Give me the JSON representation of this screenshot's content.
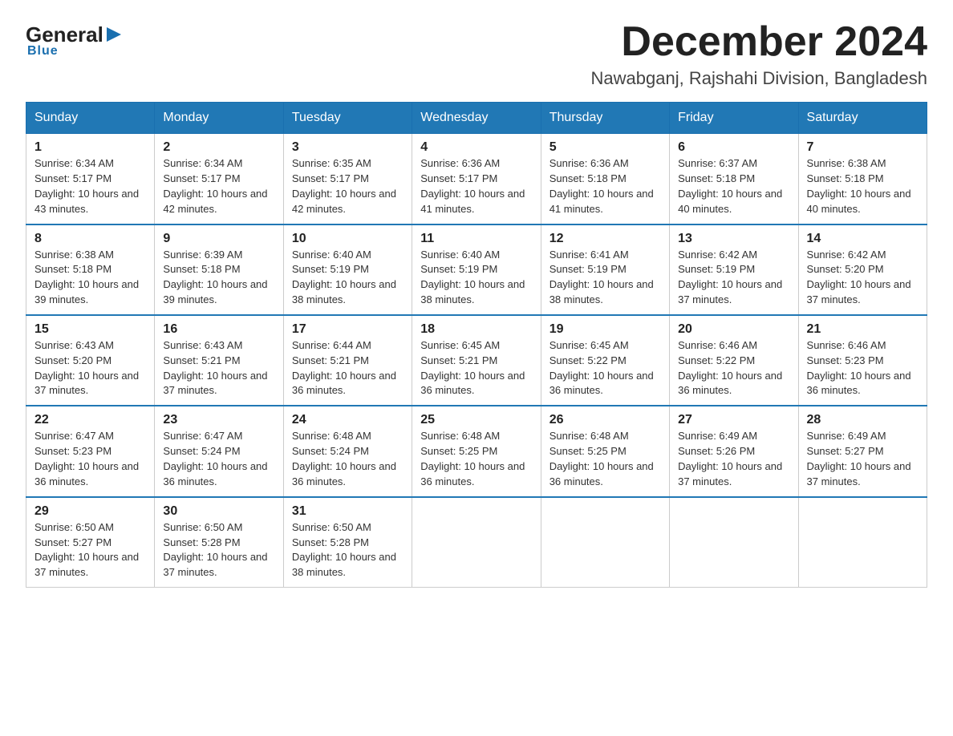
{
  "logo": {
    "general": "General",
    "blue": "Blue",
    "tagline": "Blue"
  },
  "header": {
    "title": "December 2024",
    "subtitle": "Nawabganj, Rajshahi Division, Bangladesh"
  },
  "calendar": {
    "days_of_week": [
      "Sunday",
      "Monday",
      "Tuesday",
      "Wednesday",
      "Thursday",
      "Friday",
      "Saturday"
    ],
    "weeks": [
      [
        {
          "day": "1",
          "sunrise": "6:34 AM",
          "sunset": "5:17 PM",
          "daylight": "10 hours and 43 minutes."
        },
        {
          "day": "2",
          "sunrise": "6:34 AM",
          "sunset": "5:17 PM",
          "daylight": "10 hours and 42 minutes."
        },
        {
          "day": "3",
          "sunrise": "6:35 AM",
          "sunset": "5:17 PM",
          "daylight": "10 hours and 42 minutes."
        },
        {
          "day": "4",
          "sunrise": "6:36 AM",
          "sunset": "5:17 PM",
          "daylight": "10 hours and 41 minutes."
        },
        {
          "day": "5",
          "sunrise": "6:36 AM",
          "sunset": "5:18 PM",
          "daylight": "10 hours and 41 minutes."
        },
        {
          "day": "6",
          "sunrise": "6:37 AM",
          "sunset": "5:18 PM",
          "daylight": "10 hours and 40 minutes."
        },
        {
          "day": "7",
          "sunrise": "6:38 AM",
          "sunset": "5:18 PM",
          "daylight": "10 hours and 40 minutes."
        }
      ],
      [
        {
          "day": "8",
          "sunrise": "6:38 AM",
          "sunset": "5:18 PM",
          "daylight": "10 hours and 39 minutes."
        },
        {
          "day": "9",
          "sunrise": "6:39 AM",
          "sunset": "5:18 PM",
          "daylight": "10 hours and 39 minutes."
        },
        {
          "day": "10",
          "sunrise": "6:40 AM",
          "sunset": "5:19 PM",
          "daylight": "10 hours and 38 minutes."
        },
        {
          "day": "11",
          "sunrise": "6:40 AM",
          "sunset": "5:19 PM",
          "daylight": "10 hours and 38 minutes."
        },
        {
          "day": "12",
          "sunrise": "6:41 AM",
          "sunset": "5:19 PM",
          "daylight": "10 hours and 38 minutes."
        },
        {
          "day": "13",
          "sunrise": "6:42 AM",
          "sunset": "5:19 PM",
          "daylight": "10 hours and 37 minutes."
        },
        {
          "day": "14",
          "sunrise": "6:42 AM",
          "sunset": "5:20 PM",
          "daylight": "10 hours and 37 minutes."
        }
      ],
      [
        {
          "day": "15",
          "sunrise": "6:43 AM",
          "sunset": "5:20 PM",
          "daylight": "10 hours and 37 minutes."
        },
        {
          "day": "16",
          "sunrise": "6:43 AM",
          "sunset": "5:21 PM",
          "daylight": "10 hours and 37 minutes."
        },
        {
          "day": "17",
          "sunrise": "6:44 AM",
          "sunset": "5:21 PM",
          "daylight": "10 hours and 36 minutes."
        },
        {
          "day": "18",
          "sunrise": "6:45 AM",
          "sunset": "5:21 PM",
          "daylight": "10 hours and 36 minutes."
        },
        {
          "day": "19",
          "sunrise": "6:45 AM",
          "sunset": "5:22 PM",
          "daylight": "10 hours and 36 minutes."
        },
        {
          "day": "20",
          "sunrise": "6:46 AM",
          "sunset": "5:22 PM",
          "daylight": "10 hours and 36 minutes."
        },
        {
          "day": "21",
          "sunrise": "6:46 AM",
          "sunset": "5:23 PM",
          "daylight": "10 hours and 36 minutes."
        }
      ],
      [
        {
          "day": "22",
          "sunrise": "6:47 AM",
          "sunset": "5:23 PM",
          "daylight": "10 hours and 36 minutes."
        },
        {
          "day": "23",
          "sunrise": "6:47 AM",
          "sunset": "5:24 PM",
          "daylight": "10 hours and 36 minutes."
        },
        {
          "day": "24",
          "sunrise": "6:48 AM",
          "sunset": "5:24 PM",
          "daylight": "10 hours and 36 minutes."
        },
        {
          "day": "25",
          "sunrise": "6:48 AM",
          "sunset": "5:25 PM",
          "daylight": "10 hours and 36 minutes."
        },
        {
          "day": "26",
          "sunrise": "6:48 AM",
          "sunset": "5:25 PM",
          "daylight": "10 hours and 36 minutes."
        },
        {
          "day": "27",
          "sunrise": "6:49 AM",
          "sunset": "5:26 PM",
          "daylight": "10 hours and 37 minutes."
        },
        {
          "day": "28",
          "sunrise": "6:49 AM",
          "sunset": "5:27 PM",
          "daylight": "10 hours and 37 minutes."
        }
      ],
      [
        {
          "day": "29",
          "sunrise": "6:50 AM",
          "sunset": "5:27 PM",
          "daylight": "10 hours and 37 minutes."
        },
        {
          "day": "30",
          "sunrise": "6:50 AM",
          "sunset": "5:28 PM",
          "daylight": "10 hours and 37 minutes."
        },
        {
          "day": "31",
          "sunrise": "6:50 AM",
          "sunset": "5:28 PM",
          "daylight": "10 hours and 38 minutes."
        },
        null,
        null,
        null,
        null
      ]
    ]
  }
}
